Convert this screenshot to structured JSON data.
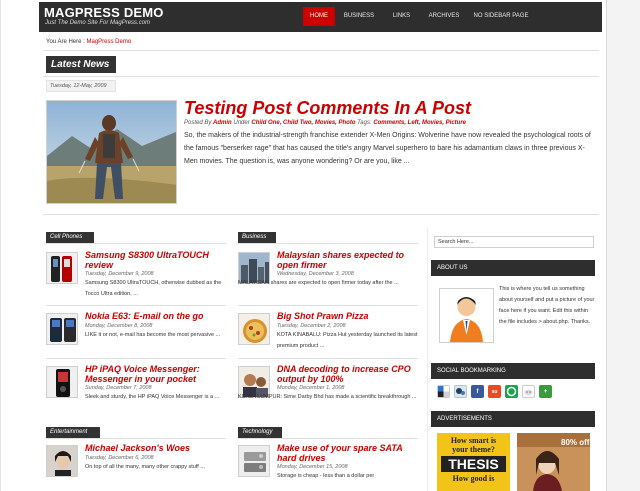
{
  "header": {
    "title": "MAGPRESS DEMO",
    "tagline": "Just The Demo Site For MagPress.com",
    "nav": [
      {
        "label": "HOME",
        "active": true
      },
      {
        "label": "BUSINESS"
      },
      {
        "label": "LINKS"
      },
      {
        "label": "ARCHIVES"
      },
      {
        "label": "NO SIDEBAR PAGE"
      }
    ]
  },
  "breadcrumb": {
    "prefix": "You Are Here :",
    "link": "MagPress Demo"
  },
  "latest_news": {
    "heading": "Latest News",
    "date": "Tuesday, 12-May, 2009",
    "title": "Testing Post Comments In A Post",
    "meta_posted_by": "Posted By",
    "meta_author": "Admin",
    "meta_under": "Under",
    "meta_categories": "Child One, Child Two, Movies, Photo",
    "meta_tags_label": "Tags:",
    "meta_tags": "Comments, Left, Movies, Picture",
    "excerpt": "So, the makers of the industrial-strength franchise extender X-Men Origins: Wolverine have now revealed the psychological roots of the famous \"berserker rage\" that has caused the title's angry Marvel superhero to bare his adamantium claws in three previous X-Men movies. The question is, was anyone wondering? Or are you, like ..."
  },
  "categories": {
    "cell_phones": {
      "label": "Cell Phones",
      "posts": [
        {
          "title": "Samsung S8300 UltraTOUCH review",
          "date": "Tuesday, December 9, 2008",
          "excerpt": "Samsung S8300 UltraTOUCH, otherwise dubbed as the Tocco Ultra edition, ..."
        },
        {
          "title": "Nokia E63: E-mail on the go",
          "date": "Monday, December 8, 2008",
          "excerpt": "LIKE it or not, e-mail has become the most pervasive ..."
        },
        {
          "title": "HP iPAQ Voice Messenger: Messenger in your pocket",
          "date": "Sunday, December 7, 2008",
          "excerpt": "Sleek and sturdy, the HP iPAQ Voice Messenger is a ..."
        }
      ]
    },
    "business": {
      "label": "Business",
      "posts": [
        {
          "title": "Malaysian shares expected to open firmer",
          "date": "Wednesday, December 3, 2008",
          "excerpt": "MALAYSIAN shares are expected to open firmer today after the ..."
        },
        {
          "title": "Big Shot Prawn Pizza",
          "date": "Tuesday, December 2, 2008",
          "excerpt": "KOTA KINABALU: Pizza Hut yesterday launched its latest premium product ..."
        },
        {
          "title": "DNA decoding to increase CPO output by 100%",
          "date": "Monday, December 1, 2008",
          "excerpt": "KUALA LUMPUR: Sime Darby Bhd has made a scientific breakthrough ..."
        }
      ]
    },
    "entertainment": {
      "label": "Entertainment",
      "posts": [
        {
          "title": "Michael Jackson's Woes",
          "date": "Tuesday, December 6, 2008",
          "excerpt": "On top of all the many, many other crappy stuff ..."
        }
      ]
    },
    "technology": {
      "label": "Technology",
      "posts": [
        {
          "title": "Make use of your spare SATA hard drives",
          "date": "Monday, December 15, 2008",
          "excerpt": "Storage is cheap - less than a dollar per"
        }
      ]
    }
  },
  "sidebar": {
    "search_value": "Search Here...",
    "about_heading": "ABOUT US",
    "about_text": "This is where you tell us something about yourself and put a picture of your face here if you want. Edit this within the file includes > about.php. Thanks.",
    "social_heading": "SOCIAL BOOKMARKING",
    "social_icons": [
      "delicious-icon",
      "digg-icon",
      "facebook-icon",
      "stumbleupon-icon",
      "technorati-icon",
      "reddit-icon",
      "share-icon"
    ],
    "ads_heading": "ADVERTISEMENTS",
    "ad1_line1": "How smart is",
    "ad1_line2": "your theme?",
    "ad1_word": "THESIS",
    "ad1_line3": "How good is",
    "ad2_text": "80% off"
  },
  "colors": {
    "accent": "#cc0000",
    "dark": "#2e2e2e"
  }
}
